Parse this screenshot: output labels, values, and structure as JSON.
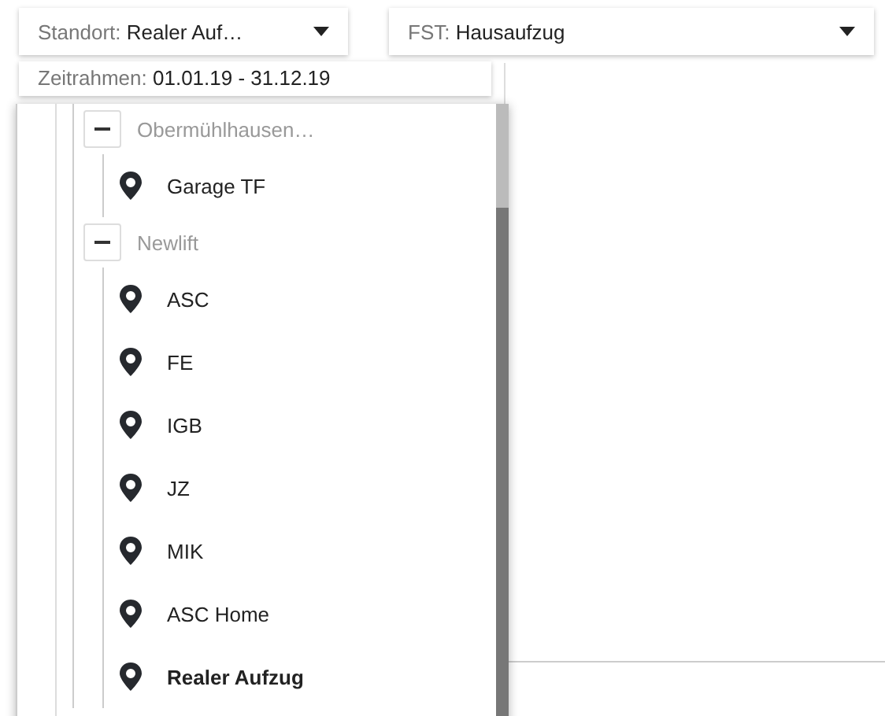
{
  "filters": [
    {
      "label": "Standort:",
      "value": "Realer Auf…"
    },
    {
      "label": "FST:",
      "value": "Hausaufzug"
    }
  ],
  "timeframe": {
    "label": "Zeitrahmen:",
    "value": "01.01.19 - 31.12.19"
  },
  "tree": [
    {
      "label": "Obermühlhausen…",
      "expanded": true,
      "children": [
        {
          "label": "Garage TF",
          "selected": false
        }
      ]
    },
    {
      "label": "Newlift",
      "expanded": true,
      "children": [
        {
          "label": "ASC",
          "selected": false
        },
        {
          "label": "FE",
          "selected": false
        },
        {
          "label": "IGB",
          "selected": false
        },
        {
          "label": "JZ",
          "selected": false
        },
        {
          "label": "MIK",
          "selected": false
        },
        {
          "label": "ASC Home",
          "selected": false
        },
        {
          "label": "Realer Aufzug",
          "selected": true
        }
      ]
    }
  ]
}
